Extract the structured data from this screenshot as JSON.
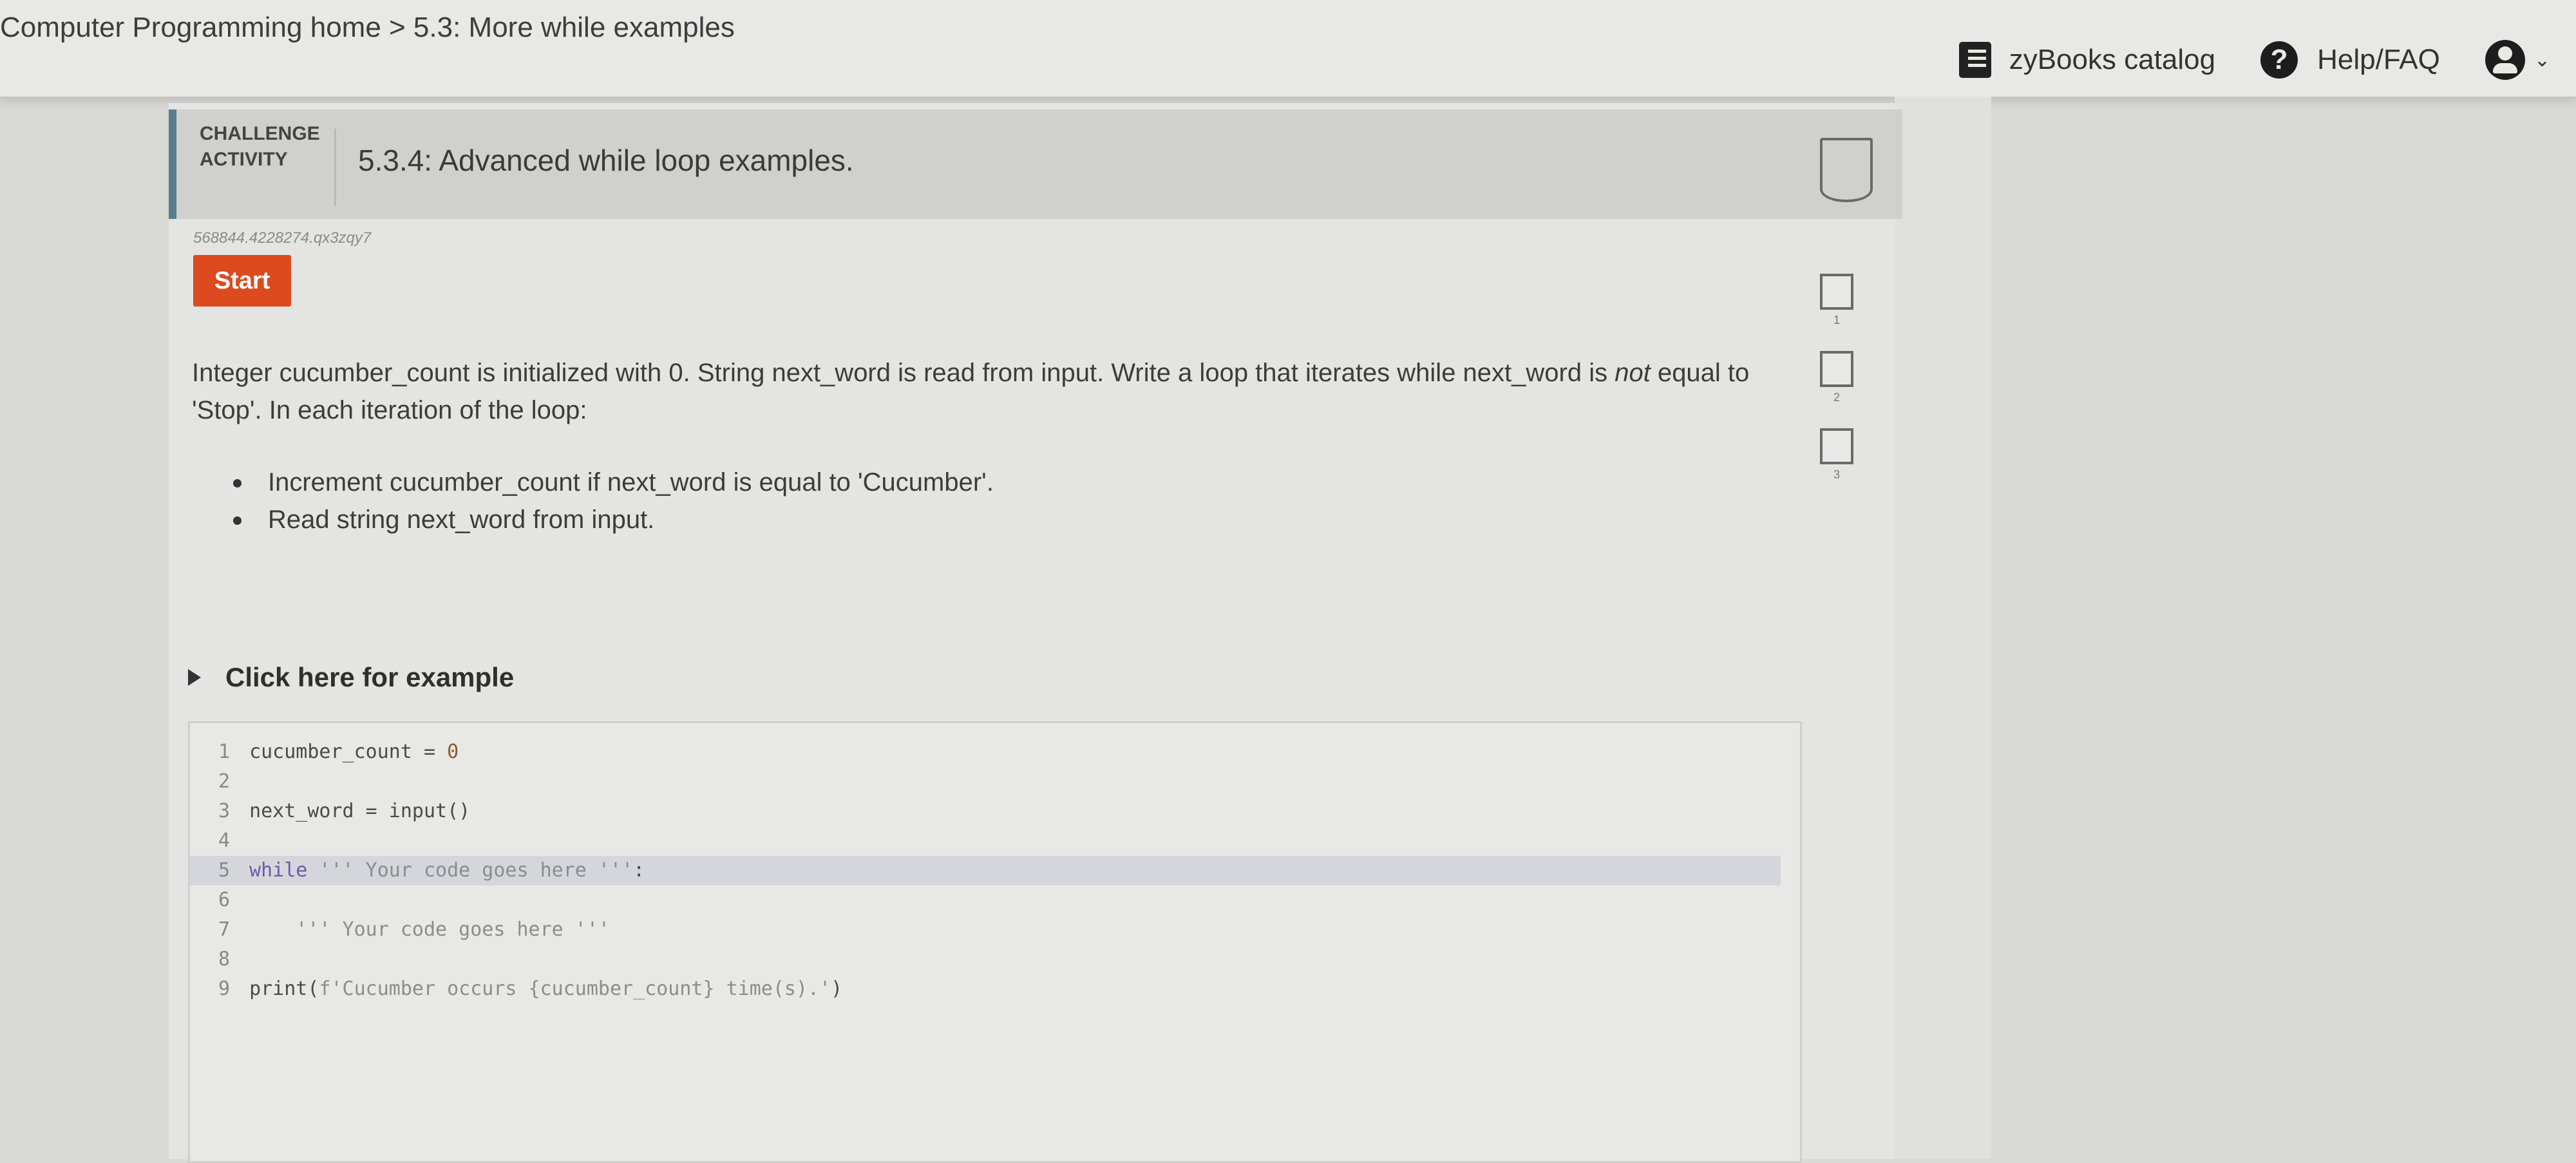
{
  "header": {
    "breadcrumb": "Computer Programming home > 5.3: More while examples",
    "catalog_label": "zyBooks catalog",
    "help_label": "Help/FAQ",
    "account_caret": "⌄"
  },
  "activity": {
    "type_label_line1": "CHALLENGE",
    "type_label_line2": "ACTIVITY",
    "title": "5.3.4: Advanced while loop examples.",
    "activity_id": "568844.4228274.qx3zqy7",
    "start_label": "Start",
    "levels": [
      "1",
      "2",
      "3"
    ],
    "prompt_part1": "Integer cucumber_count is initialized with 0. String next_word is read from input. Write a loop that iterates while next_word is ",
    "prompt_emphasis": "not",
    "prompt_part2": " equal to 'Stop'. In each iteration of the loop:",
    "bullets": [
      "Increment cucumber_count if next_word is equal to 'Cucumber'.",
      "Read string next_word from input."
    ],
    "example_toggle_label": "Click here for example"
  },
  "code": {
    "line_numbers": [
      "1",
      "2",
      "3",
      "4",
      "5",
      "6",
      "7",
      "8",
      "9"
    ],
    "line1_var": "cucumber_count = ",
    "line1_num": "0",
    "line3": "next_word = input()",
    "line5_kw": "while",
    "line5_str": " ''' Your code goes here '''",
    "line5_end": ":",
    "line7_str": "    ''' Your code goes here '''",
    "line9_call": "print(",
    "line9_str": "f'Cucumber occurs {cucumber_count} time(s).'",
    "line9_end": ")"
  },
  "colors": {
    "start_button": "#dc4a1e",
    "activity_accent": "#5a7d8f",
    "keyword": "#6d5aa8"
  }
}
